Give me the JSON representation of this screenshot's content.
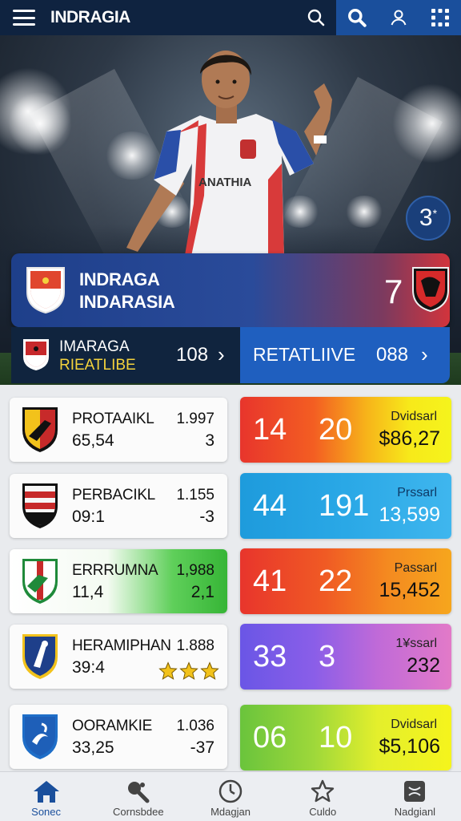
{
  "app": {
    "title": "INDRAGIA"
  },
  "hero": {
    "round_badge": "3",
    "round_badge_sup": "*"
  },
  "match": {
    "team_line1": "INDRAGA",
    "team_line2": "INDARASIA",
    "score": "7"
  },
  "subbar": {
    "left_line1": "IMARAGA",
    "left_line2": "RIEATLIBE",
    "left_value": "108",
    "right_label": "RETATLIIVE",
    "right_value": "088"
  },
  "rows": [
    {
      "name": "PROTAAIKL",
      "sub": "65,54",
      "v1": "1.997",
      "v2": "3",
      "a": "14",
      "b": "20",
      "label": "Dvidsarl",
      "amount": "$86,27"
    },
    {
      "name": "PERBACIKL",
      "sub": "09:1",
      "v1": "1.155",
      "v2": "-3",
      "a": "44",
      "b": "191",
      "label": "Prssarl",
      "amount": "13,599"
    },
    {
      "name": "ERRRUMNA",
      "sub": "11,4",
      "v1": "1,988",
      "v2": "2,1",
      "a": "41",
      "b": "22",
      "label": "Passarl",
      "amount": "15,452"
    },
    {
      "name": "HERAMIPHAN",
      "sub": "39:4",
      "v1": "1.888",
      "v2": "",
      "a": "33",
      "b": "3",
      "label": "1¥ssarl",
      "amount": "232",
      "stars": 3
    },
    {
      "name": "OORAMKIE",
      "sub": "33,25",
      "v1": "1.036",
      "v2": "-37",
      "a": "06",
      "b": "10",
      "label": "Dvidsarl",
      "amount": "$5,106"
    }
  ],
  "nav": [
    {
      "label": "Sonec",
      "icon": "home-icon"
    },
    {
      "label": "Cornsbdee",
      "icon": "whistle-icon"
    },
    {
      "label": "Mdagjan",
      "icon": "clock-icon"
    },
    {
      "label": "Culdo",
      "icon": "star-icon"
    },
    {
      "label": "Nadgianl",
      "icon": "pitch-icon"
    }
  ],
  "colors": {
    "topbar": "#0f2340",
    "accent": "#1a4f9c",
    "star": "#f2c21b"
  }
}
